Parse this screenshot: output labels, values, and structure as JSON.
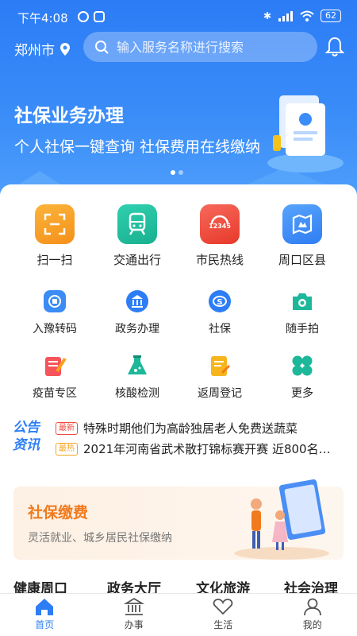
{
  "status_bar": {
    "time": "下午4:08",
    "battery": "62"
  },
  "header": {
    "city": "郑州市",
    "search_placeholder": "输入服务名称进行搜索"
  },
  "banner": {
    "title": "社保业务办理",
    "subtitle": "个人社保一键查询 社保费用在线缴纳"
  },
  "main_services": [
    {
      "label": "扫一扫",
      "icon": "scan-icon",
      "color": "#f7a21b"
    },
    {
      "label": "交通出行",
      "icon": "subway-icon",
      "color": "#22bfa0"
    },
    {
      "label": "市民热线",
      "icon": "hotline-12345-icon",
      "color": "#ef4d3f"
    },
    {
      "label": "周口区县",
      "icon": "map-icon",
      "color": "#3b8cf5"
    }
  ],
  "services_row2": [
    {
      "label": "入豫转码",
      "icon": "code-transfer-icon"
    },
    {
      "label": "政务办理",
      "icon": "government-icon"
    },
    {
      "label": "社保",
      "icon": "social-security-icon"
    },
    {
      "label": "随手拍",
      "icon": "camera-icon"
    }
  ],
  "services_row3": [
    {
      "label": "疫苗专区",
      "icon": "vaccine-icon"
    },
    {
      "label": "核酸检测",
      "icon": "flask-icon"
    },
    {
      "label": "返周登记",
      "icon": "register-icon"
    },
    {
      "label": "更多",
      "icon": "more-icon"
    }
  ],
  "news": {
    "logo_text": [
      "公告",
      "资讯"
    ],
    "items": [
      {
        "tag": "最新",
        "tag_color": "#f04b3f",
        "text": "特殊时期他们为高龄独居老人免费送蔬菜"
      },
      {
        "tag": "最热",
        "tag_color": "#f5a623",
        "text": "2021年河南省武术散打锦标赛开赛 近800名…"
      }
    ]
  },
  "promo": {
    "title": "社保缴费",
    "subtitle": "灵活就业、城乡居民社保缴纳"
  },
  "sections": [
    "健康周口",
    "政务大厅",
    "文化旅游",
    "社会治理"
  ],
  "tabbar": [
    {
      "label": "首页",
      "icon": "home-icon",
      "active": true
    },
    {
      "label": "办事",
      "icon": "building-icon",
      "active": false
    },
    {
      "label": "生活",
      "icon": "heart-icon",
      "active": false
    },
    {
      "label": "我的",
      "icon": "user-icon",
      "active": false
    }
  ],
  "colors": {
    "primary": "#2d7ef5",
    "accent": "#f07a1d"
  }
}
